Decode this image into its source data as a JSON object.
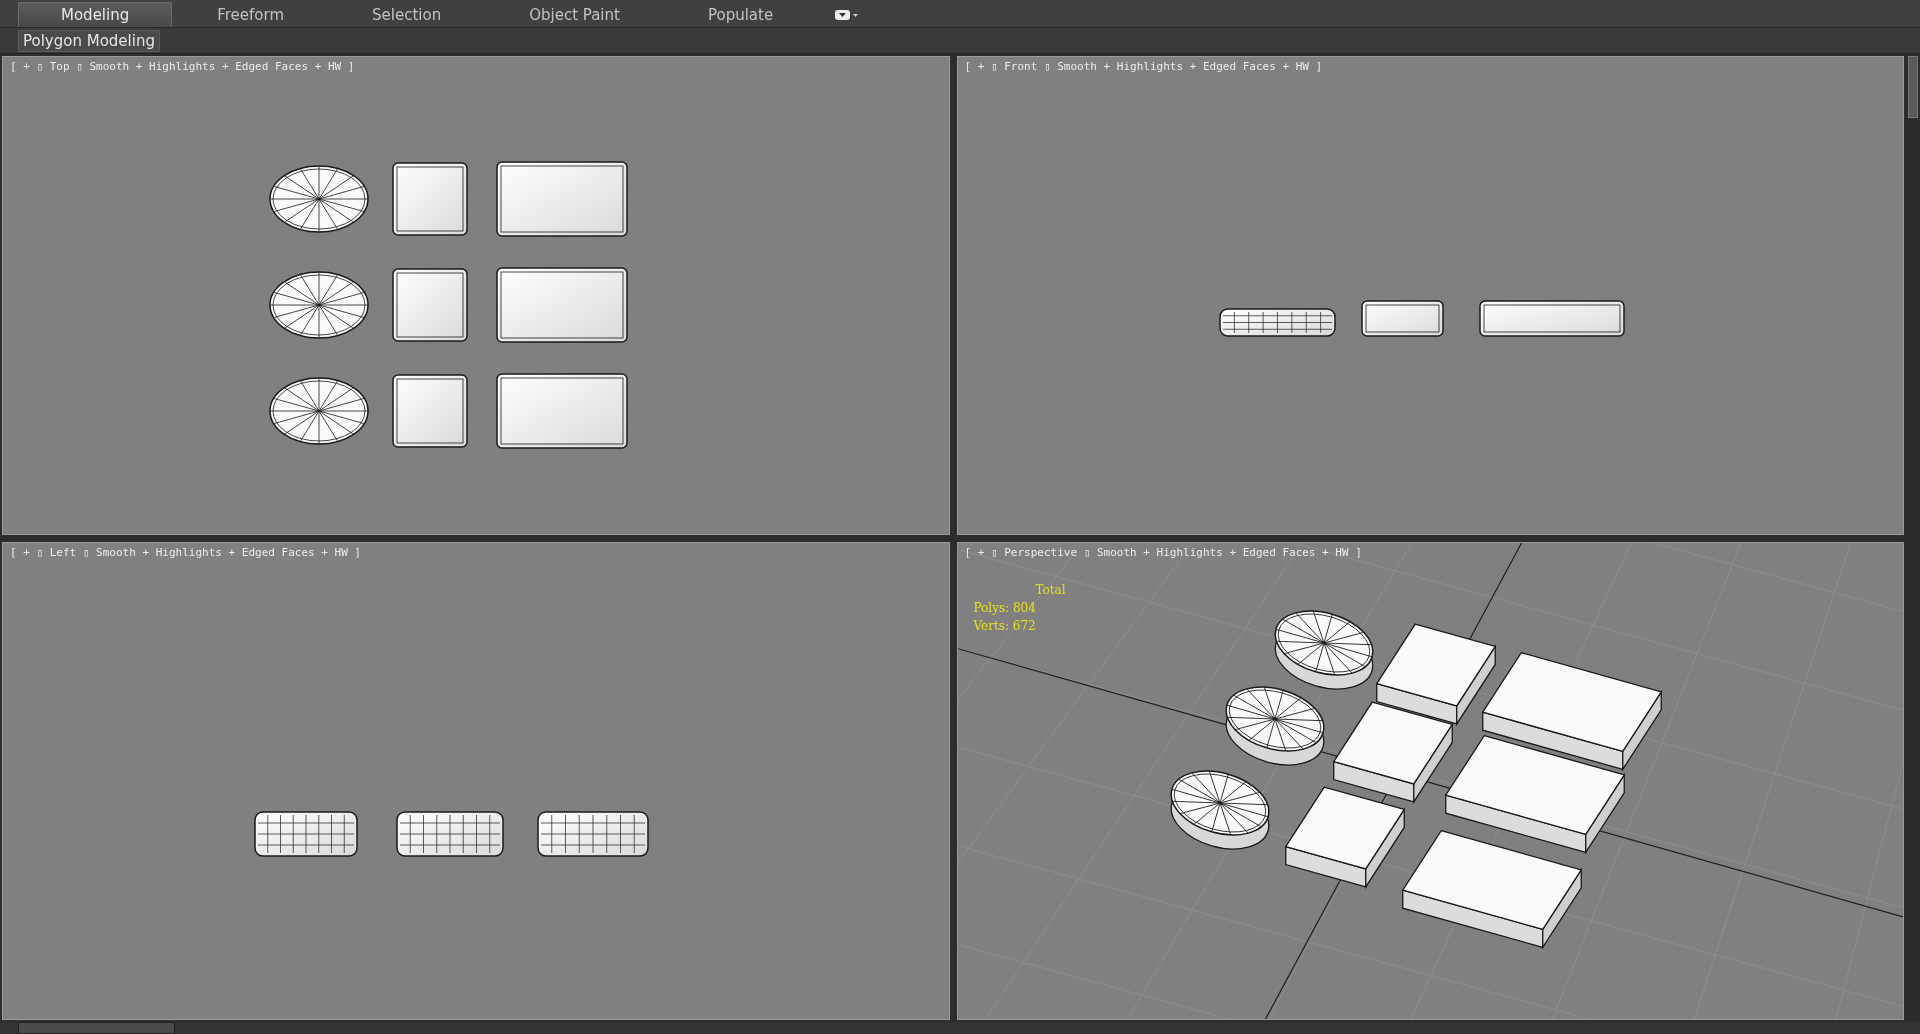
{
  "ribbon": {
    "tabs": [
      {
        "label": "Modeling",
        "selected": true
      },
      {
        "label": "Freeform",
        "selected": false
      },
      {
        "label": "Selection",
        "selected": false
      },
      {
        "label": "Object Paint",
        "selected": false
      },
      {
        "label": "Populate",
        "selected": false
      }
    ],
    "panel": "Polygon Modeling"
  },
  "viewports": [
    {
      "kind": "top",
      "label": "[ + ▯ Top ▯ Smooth + Highlights + Edged Faces + HW ]"
    },
    {
      "kind": "front",
      "label": "[ + ▯ Front ▯ Smooth + Highlights + Edged Faces + HW ]"
    },
    {
      "kind": "left",
      "label": "[ + ▯ Left ▯ Smooth + Highlights + Edged Faces + HW ]"
    },
    {
      "kind": "perspective",
      "label": "[ + ▯ Perspective ▯ Smooth + Highlights + Edged Faces + HW ]",
      "stats": {
        "title": "Total",
        "lines": [
          "Polys: 804",
          "Verts: 672"
        ]
      }
    }
  ]
}
